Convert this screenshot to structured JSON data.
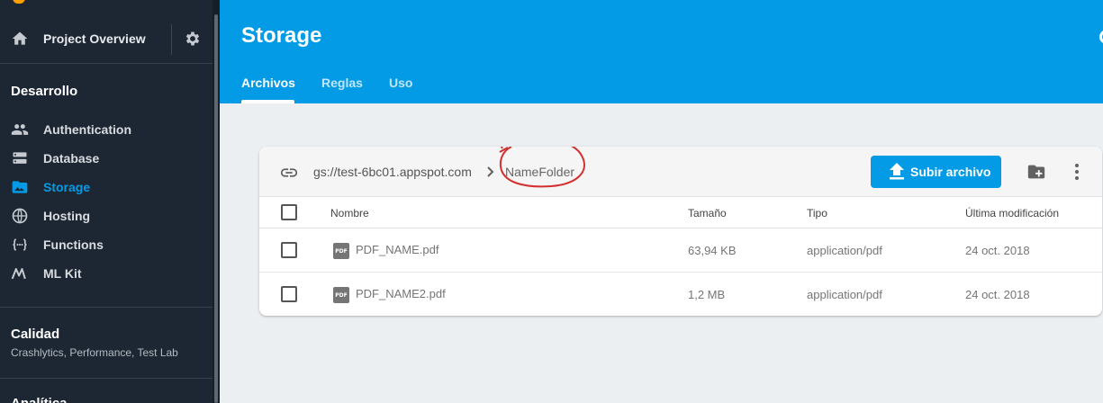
{
  "sidebar": {
    "project_overview": "Project Overview",
    "sections": {
      "desarrollo": "Desarrollo",
      "calidad": "Calidad",
      "calidad_subtitle": "Crashlytics, Performance, Test Lab",
      "analitica": "Analítica"
    },
    "items": [
      {
        "label": "Authentication",
        "icon": "people-icon"
      },
      {
        "label": "Database",
        "icon": "database-icon"
      },
      {
        "label": "Storage",
        "icon": "storage-folder-icon",
        "active": true
      },
      {
        "label": "Hosting",
        "icon": "globe-icon"
      },
      {
        "label": "Functions",
        "icon": "functions-icon"
      },
      {
        "label": "ML Kit",
        "icon": "ml-kit-icon"
      }
    ]
  },
  "header": {
    "title": "Storage",
    "tabs": [
      {
        "label": "Archivos",
        "active": true
      },
      {
        "label": "Reglas"
      },
      {
        "label": "Uso"
      }
    ]
  },
  "storage": {
    "bucket": "gs://test-6bc01.appspot.com",
    "folder": "NameFolder",
    "upload_label": "Subir archivo",
    "columns": {
      "name": "Nombre",
      "size": "Tamaño",
      "type": "Tipo",
      "modified": "Última modificación"
    },
    "files": [
      {
        "name": "PDF_NAME.pdf",
        "size": "63,94 KB",
        "type": "application/pdf",
        "modified": "24 oct. 2018"
      },
      {
        "name": "PDF_NAME2.pdf",
        "size": "1,2 MB",
        "type": "application/pdf",
        "modified": "24 oct. 2018"
      }
    ],
    "file_icon_label": "PDF"
  },
  "colors": {
    "accent": "#039be5",
    "sidebar_bg": "#1d2733",
    "annotation": "#d32f2f"
  }
}
